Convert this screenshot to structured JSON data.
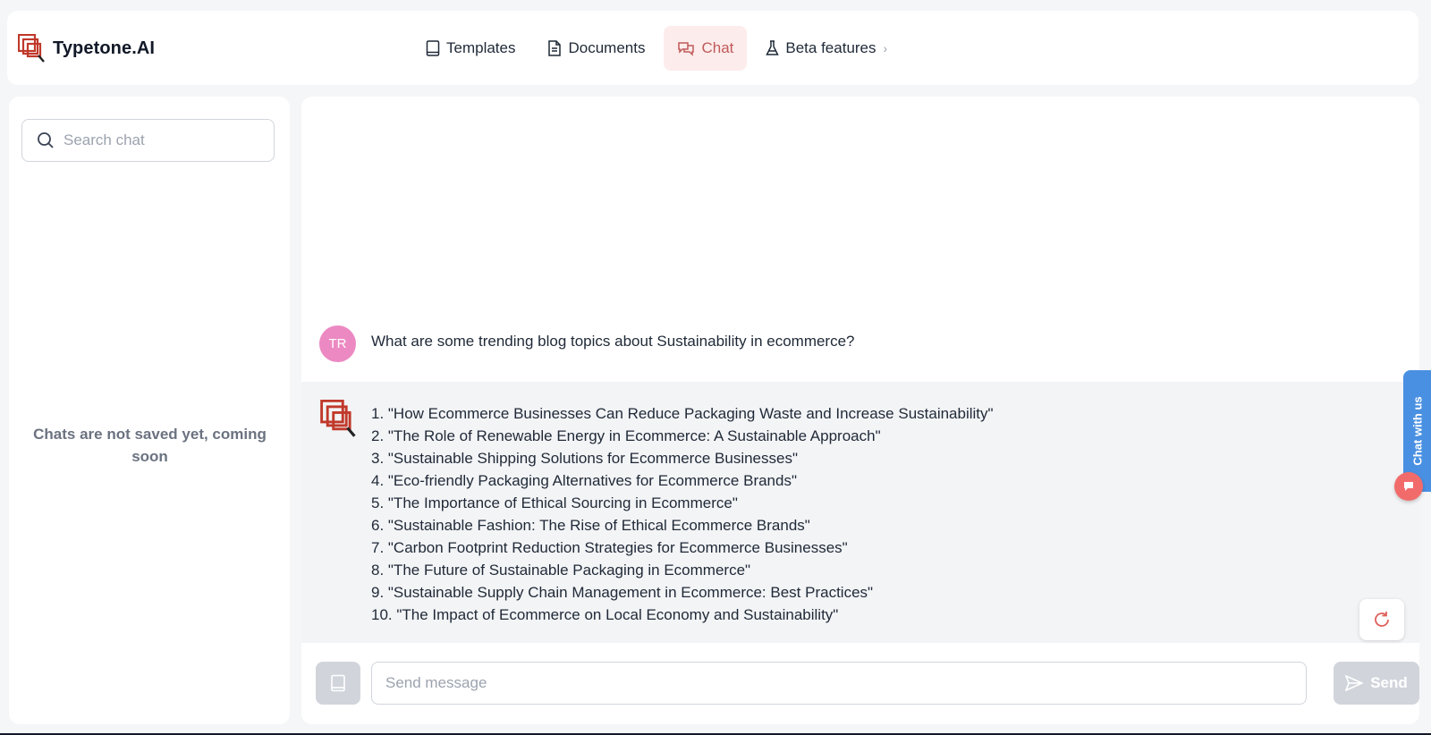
{
  "app": {
    "name": "Typetone.AI"
  },
  "nav": {
    "items": [
      {
        "label": "Templates",
        "icon": "book-icon",
        "active": false
      },
      {
        "label": "Documents",
        "icon": "document-icon",
        "active": false
      },
      {
        "label": "Chat",
        "icon": "chat-icon",
        "active": true
      },
      {
        "label": "Beta features",
        "icon": "flask-icon",
        "active": false
      }
    ]
  },
  "sidebar": {
    "search_placeholder": "Search chat",
    "empty_note": "Chats are not saved yet, coming soon"
  },
  "conversation": {
    "user": {
      "initials": "TR",
      "message": "What are some trending blog topics about Sustainability in ecommerce?"
    },
    "assistant": {
      "items": [
        "1. \"How Ecommerce Businesses Can Reduce Packaging Waste and Increase Sustainability\"",
        "2. \"The Role of Renewable Energy in Ecommerce: A Sustainable Approach\"",
        "3. \"Sustainable Shipping Solutions for Ecommerce Businesses\"",
        "4. \"Eco-friendly Packaging Alternatives for Ecommerce Brands\"",
        "5. \"The Importance of Ethical Sourcing in Ecommerce\"",
        "6. \"Sustainable Fashion: The Rise of Ethical Ecommerce Brands\"",
        "7. \"Carbon Footprint Reduction Strategies for Ecommerce Businesses\"",
        "8. \"The Future of Sustainable Packaging in Ecommerce\"",
        "9. \"Sustainable Supply Chain Management in Ecommerce: Best Practices\"",
        "10. \"The Impact of Ecommerce on Local Economy and Sustainability\""
      ]
    }
  },
  "composer": {
    "placeholder": "Send message",
    "send_label": "Send"
  },
  "widget": {
    "tab_label": "Chat with us"
  },
  "colors": {
    "accent": "#c0392b",
    "active_tab_bg": "#fdecec",
    "avatar": "#ec89c2",
    "widget_blue": "#4a90e2"
  }
}
